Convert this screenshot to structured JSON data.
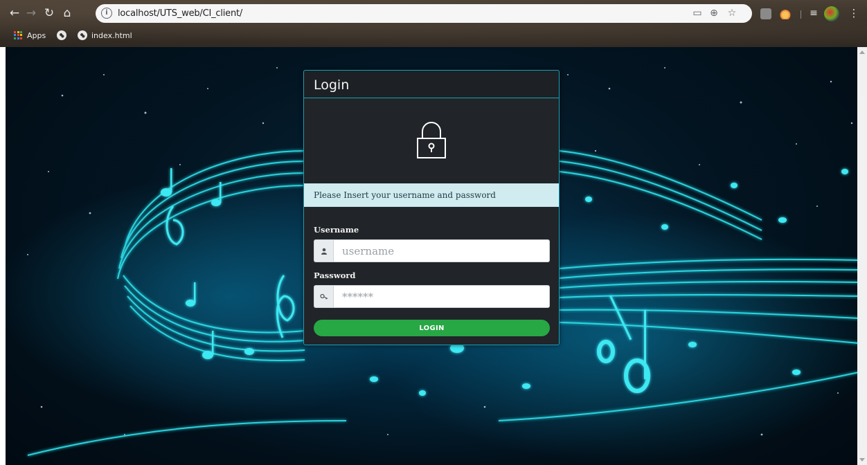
{
  "browser": {
    "url": "localhost/UTS_web/CI_client/",
    "bookmarks": {
      "apps_label": "Apps",
      "index_label": "index.html"
    }
  },
  "login": {
    "title": "Login",
    "alert": "Please Insert your username and password",
    "username_label": "Username",
    "username_placeholder": "username",
    "password_label": "Password",
    "password_placeholder": "******",
    "button_label": "LOGIN"
  },
  "colors": {
    "card_border": "#17a2b8",
    "card_bg": "#212428",
    "alert_bg": "#d1ecf1",
    "button_bg": "#28a745"
  },
  "icons": {
    "lock": "lock-icon",
    "user": "user-icon",
    "key": "key-icon"
  }
}
